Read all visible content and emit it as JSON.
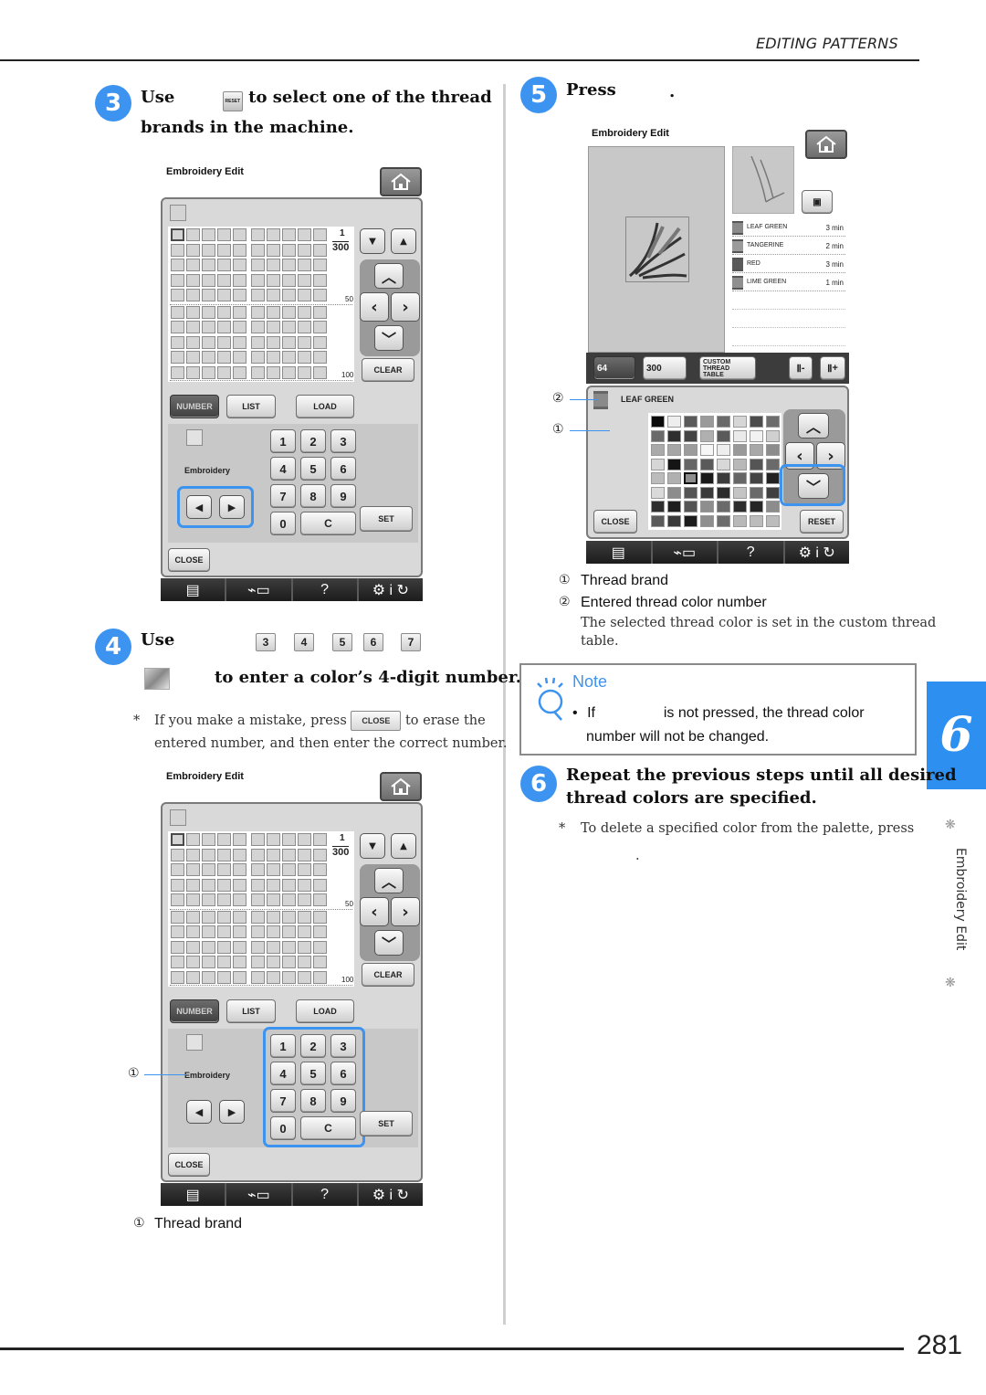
{
  "header": {
    "running_head": "EDITING PATTERNS"
  },
  "footer": {
    "page_number": "281"
  },
  "chapter_tab": {
    "number": "6",
    "label": "Embroidery Edit",
    "ornament": "❋"
  },
  "step3": {
    "badge": "3",
    "text_before": "Use",
    "inline_icon_label": "RESET",
    "text_after": "to select one of the thread",
    "line2": "brands in the machine."
  },
  "screen1": {
    "title": "Embroidery Edit",
    "fraction_top": "1",
    "fraction_bottom": "300",
    "marker_50": "50",
    "marker_100": "100",
    "clear": "CLEAR",
    "tabs": [
      "NUMBER",
      "LIST",
      "LOAD"
    ],
    "brand": "Embroidery",
    "keypad": [
      "1",
      "2",
      "3",
      "4",
      "5",
      "6",
      "7",
      "8",
      "9",
      "0",
      "C"
    ],
    "set": "SET",
    "close": "CLOSE",
    "bottom_help": "?"
  },
  "step4": {
    "badge": "4",
    "text_before": "Use",
    "keys": [
      "3",
      "4",
      "5",
      "6",
      "7"
    ],
    "line2": "to enter a color’s 4-digit number.",
    "note_star": "*",
    "note_part1": "If you make a mistake, press",
    "note_button": "CLOSE",
    "note_part2": "to erase the",
    "note_line2": "entered number, and then enter the correct number."
  },
  "screen2": {
    "title": "Embroidery Edit",
    "fraction_top": "1",
    "fraction_bottom": "300",
    "marker_50": "50",
    "marker_100": "100",
    "clear": "CLEAR",
    "tabs": [
      "NUMBER",
      "LIST",
      "LOAD"
    ],
    "brand": "Embroidery",
    "keypad": [
      "1",
      "2",
      "3",
      "4",
      "5",
      "6",
      "7",
      "8",
      "9",
      "0",
      "C"
    ],
    "set": "SET",
    "close": "CLOSE",
    "bottom_help": "?",
    "callout": "①",
    "caption_num": "①",
    "caption": "Thread brand"
  },
  "step5": {
    "badge": "5",
    "text": "Press",
    "period": "."
  },
  "screen3": {
    "title": "Embroidery Edit",
    "threads": [
      {
        "name": "LEAF GREEN",
        "time": "3 min",
        "color": "#8a8a8a"
      },
      {
        "name": "TANGERINE",
        "time": "2 min",
        "color": "#9a9a9a"
      },
      {
        "name": "RED",
        "time": "3 min",
        "color": "#5a5a5a"
      },
      {
        "name": "LIME GREEN",
        "time": "1 min",
        "color": "#8f8f8f"
      }
    ],
    "toolbar": {
      "btn64": "64",
      "btn300": "300",
      "custom_line1": "CUSTOM",
      "custom_line2": "THREAD",
      "custom_line3": "TABLE",
      "minus": "-",
      "plus": "+"
    },
    "selected_thread": "LEAF GREEN",
    "callout2": "②",
    "callout1": "①",
    "palette": [
      [
        "#0a0a0a",
        "#eeeeee",
        "#5a5a5a",
        "#9a9a9a",
        "#6a6a6a",
        "#d6d6d6",
        "#4c4c4c",
        "#6c6c6c"
      ],
      [
        "#6a6a6a",
        "#2e2e2e",
        "#444444",
        "#b0b0b0",
        "#5a5a5a",
        "#eaeaea",
        "#f2f2f2",
        "#d0d0d0"
      ],
      [
        "#aaaaaa",
        "#a6a6a6",
        "#9c9c9c",
        "#f6f6f6",
        "#eeeeee",
        "#999999",
        "#a8a8a8",
        "#8c8c8c"
      ],
      [
        "#d6d6d6",
        "#151515",
        "#666666",
        "#5a5a5a",
        "#d8d8d8",
        "#b8b8b8",
        "#555555",
        "#6a6a6a"
      ],
      [
        "#bcbcbc",
        "#b0b0b0",
        "#8e8e8e",
        "#1a1a1a",
        "#3c3c3c",
        "#666666",
        "#444444",
        "#222222"
      ],
      [
        "#dadada",
        "#8c8c8c",
        "#555555",
        "#3a3a3a",
        "#2c2c2c",
        "#c4c4c4",
        "#6a6a6a",
        "#404040"
      ],
      [
        "#2e2e2e",
        "#1e1e1e",
        "#545454",
        "#8e8e8e",
        "#6a6a6a",
        "#2c2c2c",
        "#262626",
        "#8c8c8c"
      ],
      [
        "#5a5a5a",
        "#3a3a3a",
        "#1c1c1c",
        "#8e8e8e",
        "#6c6c6c",
        "#b8b8b8",
        "#bcbcbc",
        "#bcbcbc"
      ]
    ],
    "close": "CLOSE",
    "reset": "RESET",
    "bottom_help": "?"
  },
  "legend5": {
    "items": [
      {
        "num": "①",
        "label": "Thread brand"
      },
      {
        "num": "②",
        "label": "Entered thread color number"
      }
    ],
    "desc_line1": "The selected thread color is set in the custom thread",
    "desc_line2": "table."
  },
  "note": {
    "title": "Note",
    "bullet": "•",
    "part1": "If",
    "part2": "is not pressed, the thread color",
    "line2": "number will not be changed."
  },
  "step6": {
    "badge": "6",
    "line1": "Repeat the previous steps until all desired",
    "line2": "thread colors are specified.",
    "star": "*",
    "note_line1": "To delete a specified color from the palette, press",
    "note_line2": "."
  },
  "colors": {
    "accent": "#3d93f0",
    "chapter_tab": "#2d8ff0"
  }
}
